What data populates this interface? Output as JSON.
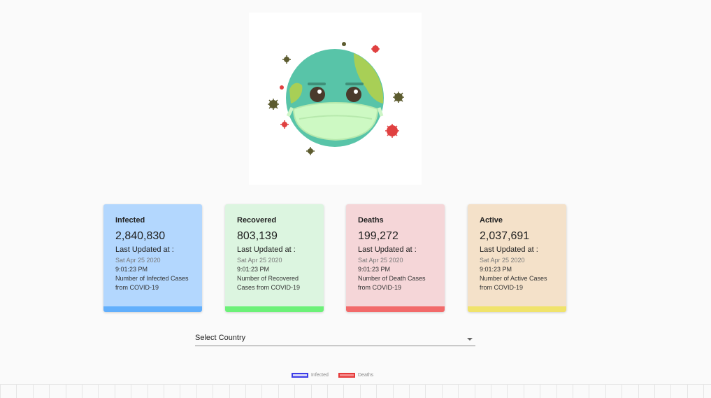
{
  "logo": {
    "name": "masked-earth-illustration"
  },
  "cards": [
    {
      "title": "Infected",
      "value": "2,840,830",
      "updated_label": "Last Updated at :",
      "date": "Sat Apr 25 2020",
      "time": "9:01:23 PM",
      "description": "Number of Infected Cases from COVID-19",
      "bg": "#b3d7fe",
      "accent": "#62affc"
    },
    {
      "title": "Recovered",
      "value": "803,139",
      "updated_label": "Last Updated at :",
      "date": "Sat Apr 25 2020",
      "time": "9:01:23 PM",
      "description": "Number of Recovered Cases from COVID-19",
      "bg": "#dcf5e0",
      "accent": "#6cf178"
    },
    {
      "title": "Deaths",
      "value": "199,272",
      "updated_label": "Last Updated at :",
      "date": "Sat Apr 25 2020",
      "time": "9:01:23 PM",
      "description": "Number of Death Cases from COVID-19",
      "bg": "#f5d6d8",
      "accent": "#f26a6a"
    },
    {
      "title": "Active",
      "value": "2,037,691",
      "updated_label": "Last Updated at :",
      "date": "Sat Apr 25 2020",
      "time": "9:01:23 PM",
      "description": "Number of Active Cases from COVID-19",
      "bg": "#f4e1c9",
      "accent": "#f0e36b"
    }
  ],
  "country_select": {
    "label": "Select Country"
  },
  "chart_legend": [
    {
      "label": "Infected",
      "border": "#3d3de8",
      "fill": "#d7d7f7"
    },
    {
      "label": "Deaths",
      "border": "#e53b3b",
      "fill": "#f58a8a"
    }
  ]
}
